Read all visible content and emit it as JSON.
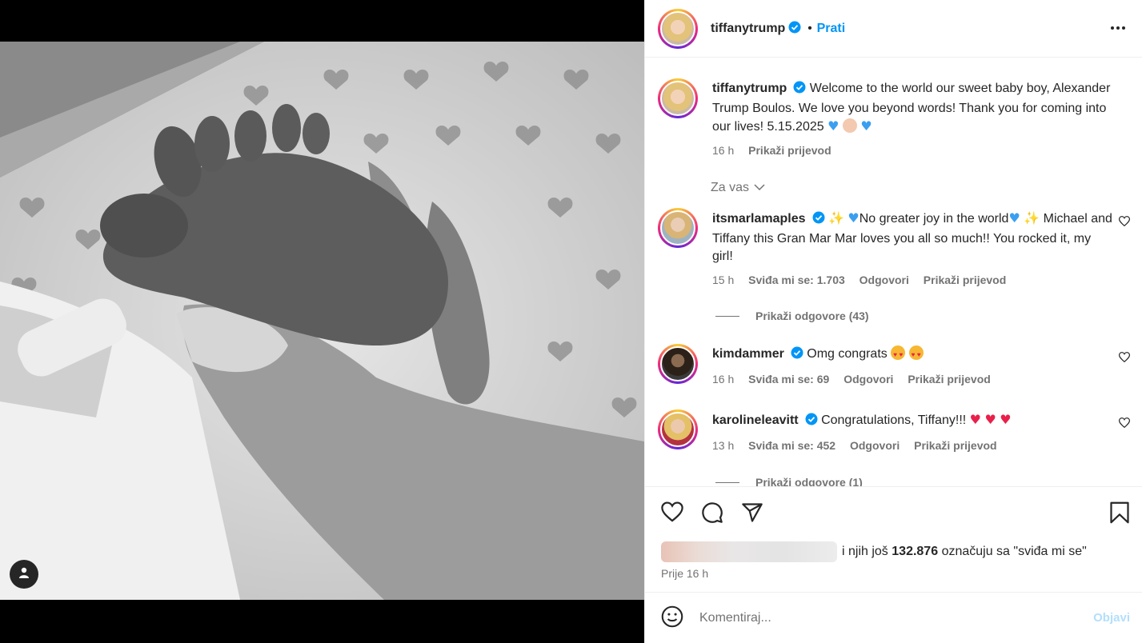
{
  "post": {
    "author": "tiffanytrump",
    "follow_label": "Prati",
    "dot": "•",
    "caption": "Welcome to the world our sweet baby boy, Alexander Trump Boulos. We love you beyond words! Thank you for coming into our lives! 5.15.2025",
    "caption_time": "16 h",
    "caption_translate": "Prikaži prijevod"
  },
  "sort": {
    "label": "Za vas"
  },
  "comments": [
    {
      "user": "itsmarlamaples",
      "text_before": "No greater joy in the world",
      "text_after": "Michael and Tiffany this Gran Mar Mar loves you all so much!! You rocked it, my girl!",
      "time": "15 h",
      "likes": "Sviđa mi se: 1.703",
      "reply": "Odgovori",
      "translate": "Prikaži prijevod",
      "replies": "Prikaži odgovore (43)"
    },
    {
      "user": "kimdammer",
      "text": "Omg congrats",
      "time": "16 h",
      "likes": "Sviđa mi se: 69",
      "reply": "Odgovori",
      "translate": "Prikaži prijevod"
    },
    {
      "user": "karolineleavitt",
      "text": "Congratulations, Tiffany!!!",
      "time": "13 h",
      "likes": "Sviđa mi se: 452",
      "reply": "Odgovori",
      "translate": "Prikaži prijevod",
      "replies": "Prikaži odgovore (1)"
    }
  ],
  "likes": {
    "prefix": "i njih još",
    "count": "132.876",
    "suffix": "označuju sa \"sviđa mi se\""
  },
  "time_ago": "Prije 16 h",
  "comment_box": {
    "placeholder": "Komentiraj...",
    "post_label": "Objavi"
  },
  "colors": {
    "accent": "#0095f6",
    "verified": "#0095f6",
    "muted": "#737373"
  },
  "icons": [
    "tag-user-icon",
    "more-icon",
    "verified-icon",
    "heart-icon",
    "comment-icon",
    "share-icon",
    "bookmark-icon",
    "emoji-icon",
    "chevron-down-icon"
  ]
}
